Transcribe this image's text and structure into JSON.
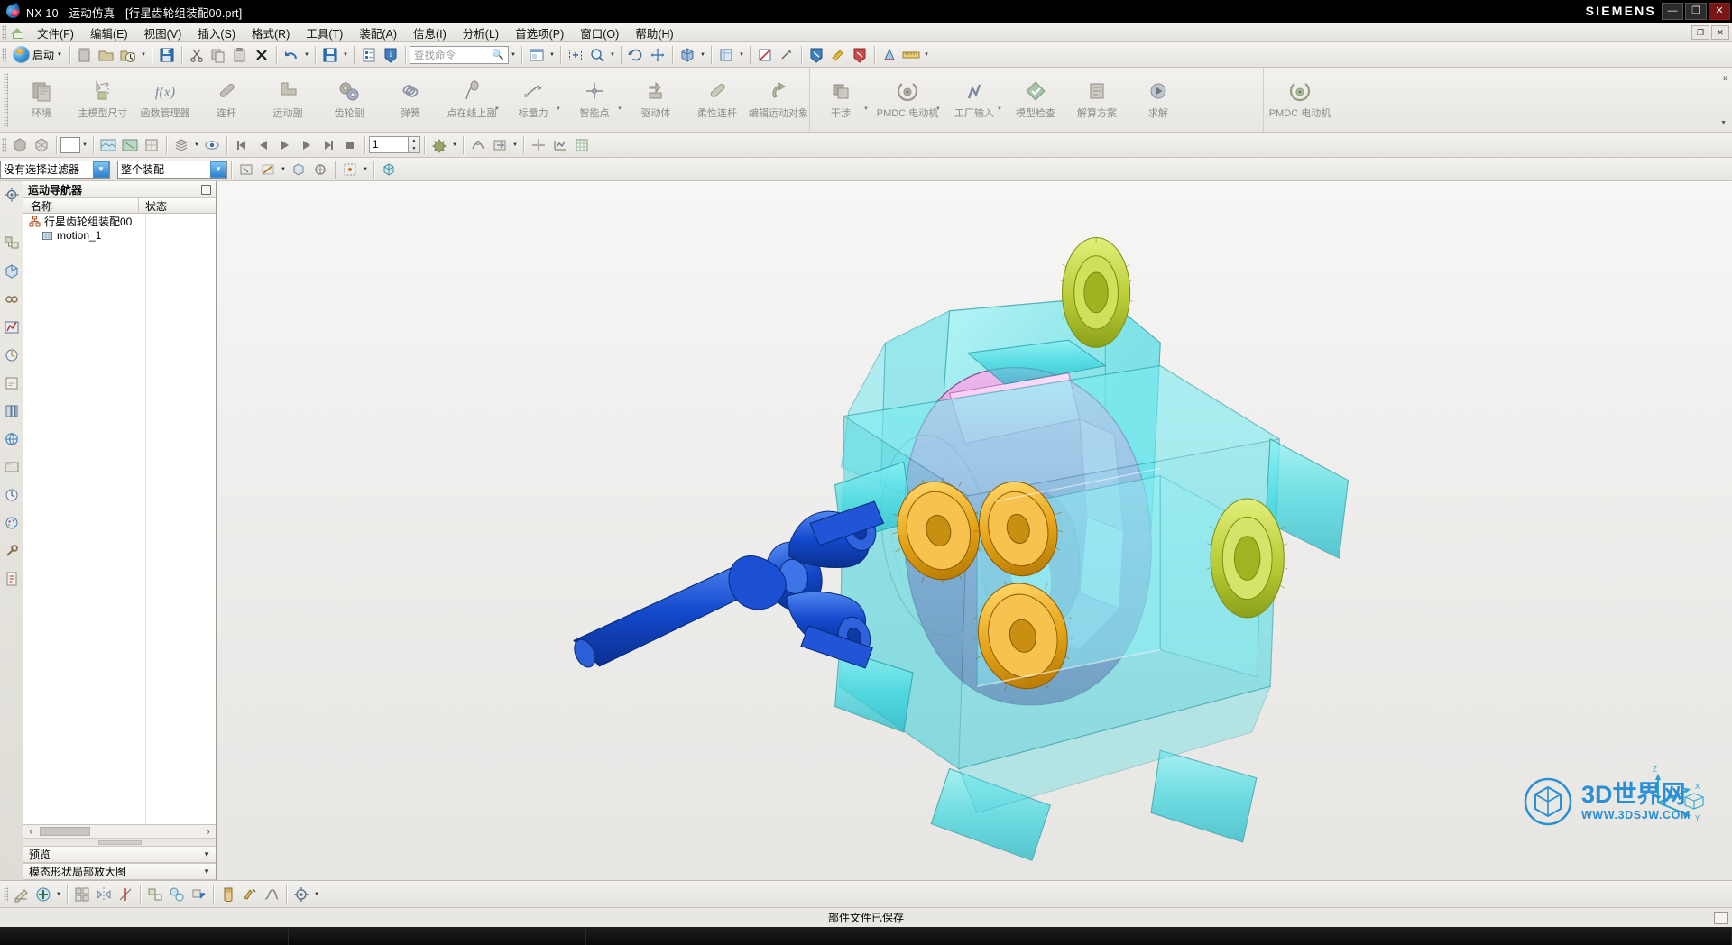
{
  "window": {
    "title": "NX 10 - 运动仿真 - [行星齿轮组装配00.prt]",
    "brand": "SIEMENS",
    "minimize": "—",
    "maximize": "❐",
    "close": "✕"
  },
  "menubar": {
    "items": [
      {
        "label": "文件(F)",
        "name": "menu-file"
      },
      {
        "label": "编辑(E)",
        "name": "menu-edit"
      },
      {
        "label": "视图(V)",
        "name": "menu-view"
      },
      {
        "label": "插入(S)",
        "name": "menu-insert"
      },
      {
        "label": "格式(R)",
        "name": "menu-format"
      },
      {
        "label": "工具(T)",
        "name": "menu-tools"
      },
      {
        "label": "装配(A)",
        "name": "menu-assembly"
      },
      {
        "label": "信息(I)",
        "name": "menu-info"
      },
      {
        "label": "分析(L)",
        "name": "menu-analysis"
      },
      {
        "label": "首选项(P)",
        "name": "menu-preferences"
      },
      {
        "label": "窗口(O)",
        "name": "menu-window"
      },
      {
        "label": "帮助(H)",
        "name": "menu-help"
      }
    ]
  },
  "toolbar_standard": {
    "start_label": "启动",
    "search_placeholder": "查找命令",
    "search_value": ""
  },
  "ribbon": {
    "groups": [
      {
        "name": "group-setup",
        "buttons": [
          {
            "label": "环境",
            "icon": "environment-icon",
            "caret": false
          },
          {
            "label": "主模型尺寸",
            "icon": "master-model-dimension-icon",
            "caret": false
          }
        ]
      },
      {
        "name": "group-mechanism",
        "buttons": [
          {
            "label": "函数管理器",
            "icon": "function-manager-icon",
            "caret": false
          },
          {
            "label": "连杆",
            "icon": "link-icon",
            "caret": false
          },
          {
            "label": "运动副",
            "icon": "joint-icon",
            "caret": false
          },
          {
            "label": "齿轮副",
            "icon": "gear-pair-icon",
            "caret": false
          },
          {
            "label": "弹簧",
            "icon": "spring-icon",
            "caret": false
          },
          {
            "label": "点在线上副",
            "icon": "point-on-curve-icon",
            "caret": true
          },
          {
            "label": "标量力",
            "icon": "scalar-force-icon",
            "caret": true
          },
          {
            "label": "智能点",
            "icon": "smart-point-icon",
            "caret": true
          },
          {
            "label": "驱动体",
            "icon": "driver-body-icon",
            "caret": false
          },
          {
            "label": "柔性连杆",
            "icon": "flexible-link-icon",
            "caret": false
          },
          {
            "label": "编辑运动对象",
            "icon": "edit-motion-object-icon",
            "caret": false
          }
        ]
      },
      {
        "name": "group-analysis",
        "buttons": [
          {
            "label": "干涉",
            "icon": "interference-icon",
            "caret": true
          },
          {
            "label": "PMDC 电动机",
            "icon": "pmdc-motor-icon",
            "caret": true
          },
          {
            "label": "工厂输入",
            "icon": "plant-input-icon",
            "caret": true
          },
          {
            "label": "模型检查",
            "icon": "model-check-icon",
            "caret": false
          },
          {
            "label": "解算方案",
            "icon": "solution-icon",
            "caret": false
          },
          {
            "label": "求解",
            "icon": "solve-icon",
            "caret": false
          }
        ]
      },
      {
        "name": "group-electrical",
        "buttons": [
          {
            "label": "PMDC 电动机",
            "icon": "pmdc-motor-2-icon",
            "caret": false
          }
        ]
      }
    ],
    "overflow": "»"
  },
  "toolbar_playback": {
    "frame_value": "1",
    "color_swatch": "#ffffff"
  },
  "toolbar_filter": {
    "selection_filter": "没有选择过滤器",
    "scope": "整个装配"
  },
  "navigator": {
    "title": "运动导航器",
    "columns": [
      "名称",
      "状态"
    ],
    "tree": [
      {
        "label": "行星齿轮组装配00",
        "icon": "assembly-icon",
        "level": 1
      },
      {
        "label": "motion_1",
        "icon": "motion-sim-icon",
        "level": 2
      }
    ]
  },
  "bottom_panels": [
    {
      "label": "预览",
      "name": "preview-panel"
    },
    {
      "label": "模态形状局部放大图",
      "name": "modal-shape-detail-panel"
    }
  ],
  "viewport": {
    "model_name": "行星齿轮组装配00",
    "triad_labels": [
      "X",
      "Y",
      "Z"
    ],
    "watermark_main": "3D世界网",
    "watermark_sub": "WWW.3DSJW.COM"
  },
  "statusbar": {
    "message": "部件文件已保存"
  },
  "colors": {
    "housing": "#3fd8e0",
    "carrier": "#c86bc0",
    "carrier_light": "#f0a8ea",
    "gear_orange": "#e09b10",
    "gear_green": "#b6c832",
    "shaft_blue": "#1349cc",
    "accent": "#2a8fd4"
  }
}
